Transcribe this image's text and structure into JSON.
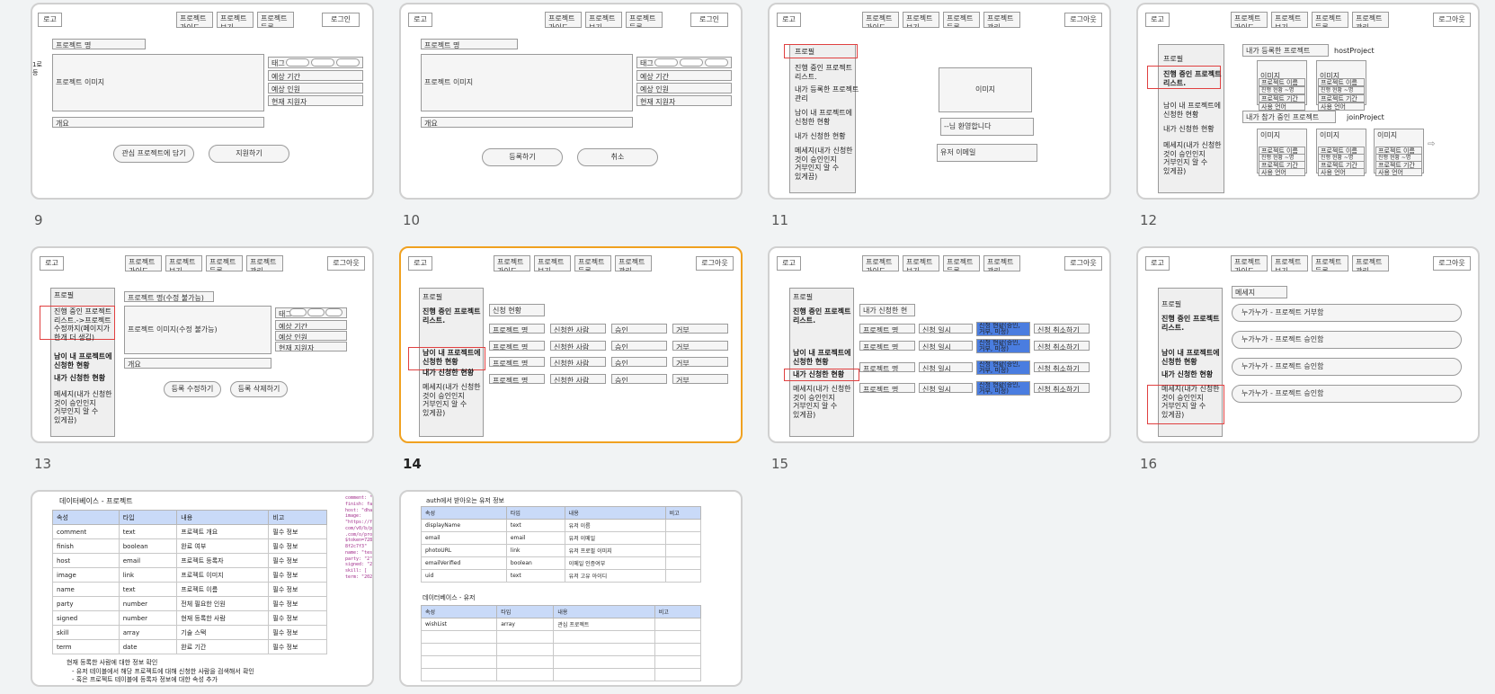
{
  "common": {
    "logo": "로고",
    "nav_guide": "프로젝트\n가이드",
    "nav_view": "프로젝트\n보기",
    "nav_register": "프로젝트\n등록",
    "nav_manage": "프로젝트\n관리",
    "login": "로그인",
    "logout": "로그아웃",
    "profile": "프로필",
    "side_ongoing": "진행 중인 프로젝트\n리스트.",
    "side_my_registered": "내가 등록한 프로젝트\n관리",
    "side_applied_to_mine": "남이 내 프로젝트에\n신청한 현황",
    "side_my_applications": "내가 신청한 현황",
    "side_messages": "메세지(내가 신청한\n것이 승인인지\n거부인지 알 수\n있게끔)",
    "project_name": "프로젝트 명",
    "project_image": "프로젝트 이미지",
    "overview": "개요",
    "tag": "태그",
    "est_period": "예상 기간",
    "est_people": "예상 인원",
    "current_applicants": "현재 지원자",
    "image": "이미지"
  },
  "slides": {
    "s9": {
      "number": "9",
      "side_text": "1로\n등",
      "btn_wish": "관심 프로젝트에 담기",
      "btn_apply": "지원하기"
    },
    "s10": {
      "number": "10",
      "btn_register": "등록하기",
      "btn_cancel": "취소"
    },
    "s11": {
      "number": "11",
      "welcome": "--님 환영합니다",
      "user_email": "유저 이메일"
    },
    "s12": {
      "number": "12",
      "my_registered": "내가 등록한 프로젝트",
      "host_label": "hostProject",
      "my_joined": "내가 참가 중인 프로젝트",
      "join_label": "joinProject",
      "card_name": "프로젝트 이름",
      "card_status": "진행 현황 ~명\n중 ~명",
      "card_period": "프로젝트 기간",
      "card_lang": "사용 언어"
    },
    "s13": {
      "number": "13",
      "side_ongoing_edit": "진행 중인 프로젝트\n리스트.->프로젝트\n수정까지(페이지가\n한개 더 생김)",
      "name_edit": "프로젝트 명(수정 불가능)",
      "image_edit": "프로젝트 이미지(수정 불가능)",
      "btn_edit": "등록 수정하기",
      "btn_delete": "등록 삭제하기"
    },
    "s14": {
      "number": "14",
      "status_title": "신청 현황",
      "col_name": "프로젝트 명",
      "col_applicant": "신청한 사람",
      "col_approve": "승인",
      "col_reject": "거부"
    },
    "s15": {
      "number": "15",
      "title": "내가 신청한 현황",
      "col_name": "프로젝트 명",
      "col_date": "신청 일시",
      "col_status": "신청 현황(승인,\n거부, 미정)",
      "col_cancel": "신청 취소하기"
    },
    "s16": {
      "number": "16",
      "messages_title": "메세지",
      "msg1": "누가누가 - 프로젝트 거부함",
      "msg2": "누가누가 - 프로젝트 승인함",
      "msg3": "누가누가 - 프로젝트 승인함",
      "msg4": "누가누가 - 프로젝트 승인함"
    },
    "s17": {
      "title": "데이터베이스 - 프로젝트",
      "headers": [
        "속성",
        "타입",
        "내용",
        "비고"
      ],
      "rows": [
        [
          "comment",
          "text",
          "프로젝트 개요",
          "필수 정보"
        ],
        [
          "finish",
          "boolean",
          "완료 여부",
          "필수 정보"
        ],
        [
          "host",
          "email",
          "프로젝트 등록자",
          "필수 정보"
        ],
        [
          "image",
          "link",
          "프로젝트 이미지",
          "필수 정보"
        ],
        [
          "name",
          "text",
          "프로젝트 이름",
          "필수 정보"
        ],
        [
          "party",
          "number",
          "전체 필요한 인원",
          "필수 정보"
        ],
        [
          "signed",
          "number",
          "현재 등록한 사람",
          "필수 정보"
        ],
        [
          "skill",
          "array",
          "기술 스택",
          "필수 정보"
        ],
        [
          "term",
          "date",
          "완료 기간",
          "필수 정보"
        ]
      ],
      "note1": "현재 등록한 사람에 대한 정보 확인",
      "note2": "-    유저 테이블에서 해당 프로젝트에 대해 신청한 사람을 검색해서 확인",
      "note3": "-    혹은 프로젝트 테이블에 등록자 정보에 대한 속성 추가",
      "code": "comment: \"\nfinish: fa\nhost: \"dha\nimage:\n\"https://f\ncom/v0/b/p\n.com/o/pro\n$token=728\n8f2c7f3\"\nname: \"tes\nparty: \"2\"\nsigned: \"2\nskill: [\nterm: \"202"
    },
    "s18": {
      "title1": "auth에서 받아오는 유저 정보",
      "headers": [
        "속성",
        "타입",
        "내용",
        "비고"
      ],
      "rows1": [
        [
          "displayName",
          "text",
          "유저 이름",
          ""
        ],
        [
          "email",
          "email",
          "유저 이메일",
          ""
        ],
        [
          "photoURL",
          "link",
          "유저 프로필 이미지",
          ""
        ],
        [
          "emailVerified",
          "boolean",
          "이메일 인증여부",
          ""
        ],
        [
          "uid",
          "text",
          "유저 고유 아이디",
          ""
        ]
      ],
      "title2": "데이터베이스 - 유저",
      "rows2": [
        [
          "wishList",
          "array",
          "관심 프로젝트",
          ""
        ]
      ]
    }
  }
}
